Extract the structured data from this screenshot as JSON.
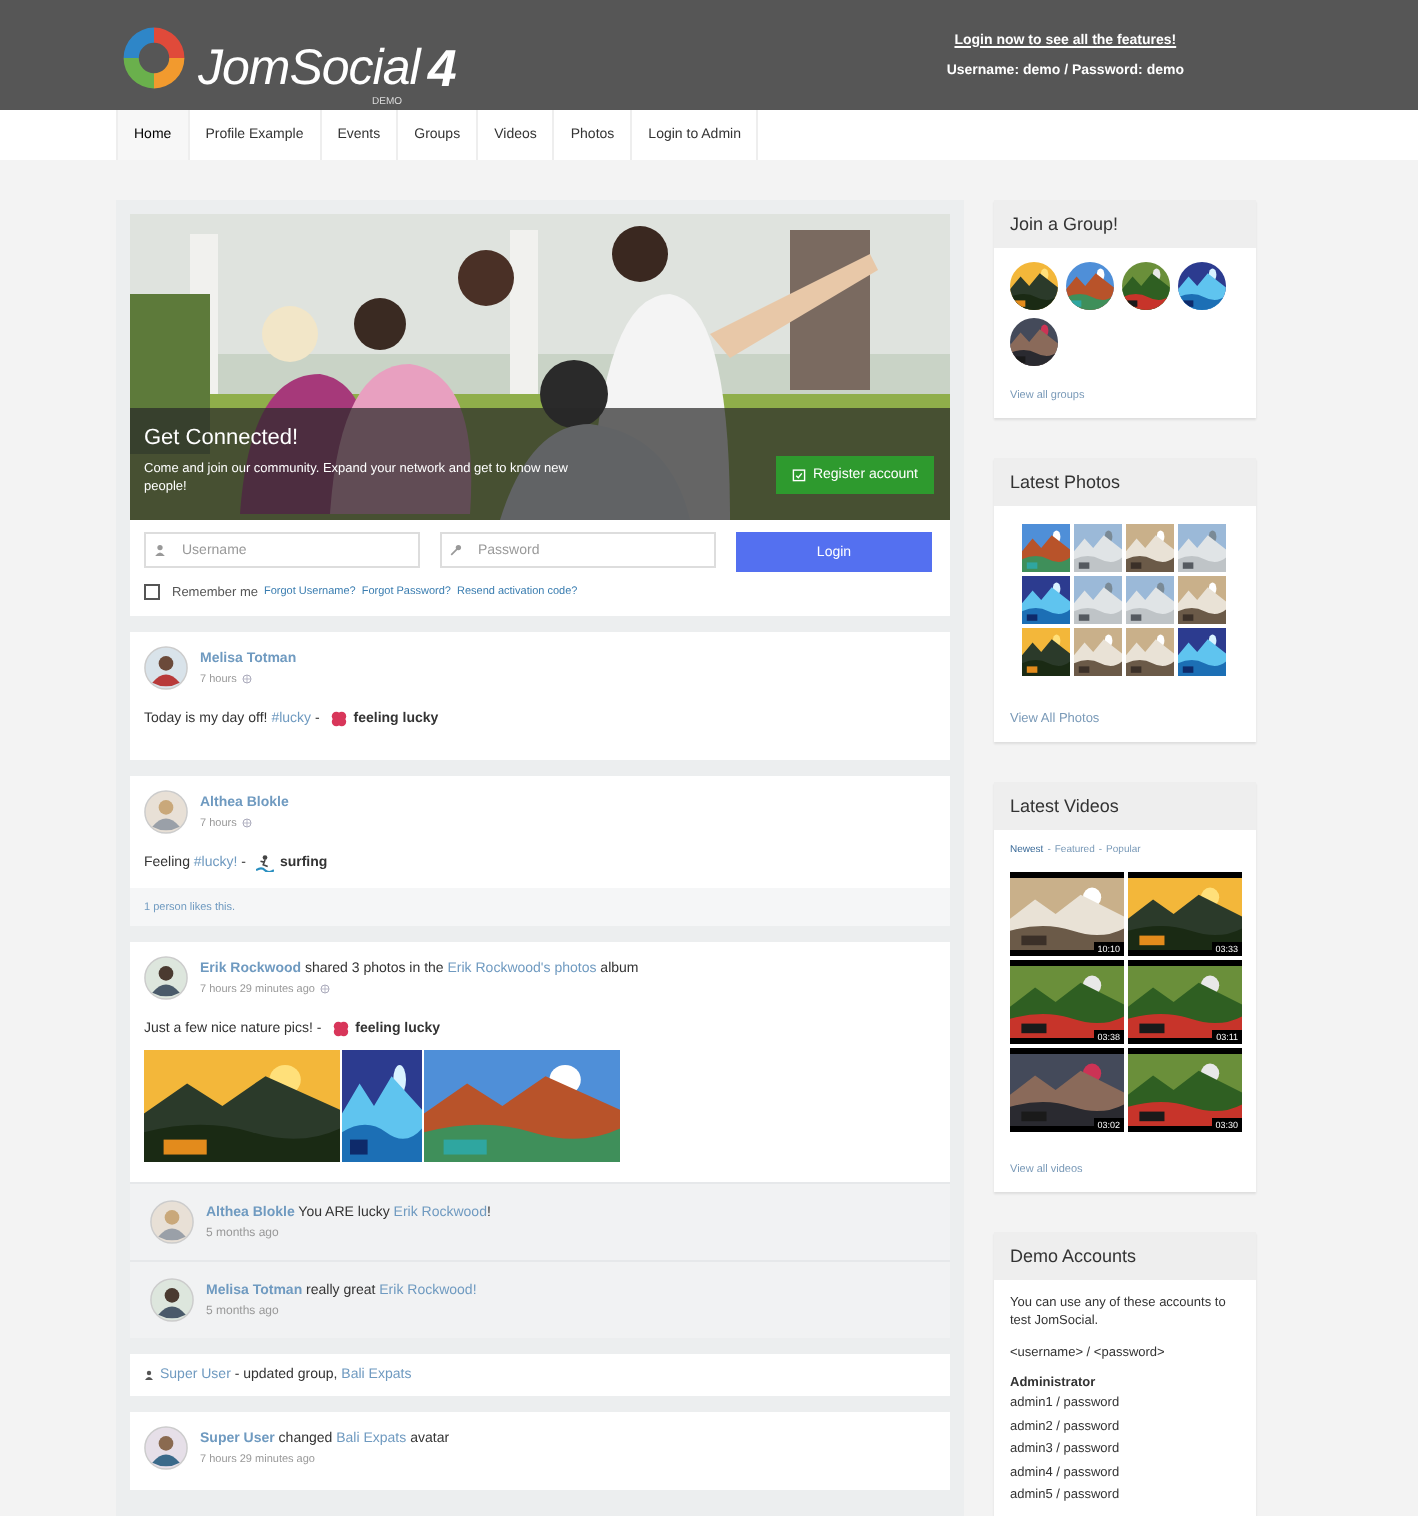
{
  "header": {
    "logo": {
      "name": "JomSocial",
      "version": "4",
      "edition": "DEMO"
    },
    "login_link": "Login now to see all the features!",
    "credentials": "Username: demo / Password: demo"
  },
  "nav": [
    {
      "label": "Home",
      "selected": true
    },
    {
      "label": "Profile Example",
      "selected": false
    },
    {
      "label": "Events",
      "selected": false
    },
    {
      "label": "Groups",
      "selected": false
    },
    {
      "label": "Videos",
      "selected": false
    },
    {
      "label": "Photos",
      "selected": false
    },
    {
      "label": "Login to Admin",
      "selected": false
    }
  ],
  "hero": {
    "kind": "picture",
    "title": "Get Connected!",
    "text": "Come and join our community. Expand your network and get to know new people!",
    "register_button": "Register account",
    "username": {
      "placeholder": "Username"
    },
    "password": {
      "placeholder": "Password"
    },
    "login_button": "Login",
    "remember": {
      "label": "Remember me",
      "checked": false
    },
    "links": [
      "Forgot Username?",
      "Forgot Password?",
      "Resend activation code?"
    ]
  },
  "feed": [
    {
      "kind": "post",
      "headline": [
        {
          "text": "Melisa Totman",
          "link": true
        }
      ],
      "time": "7 hours",
      "message": [
        {
          "text": "Today is my day off! "
        },
        {
          "text": "#lucky",
          "link": true
        },
        {
          "text": " - "
        }
      ],
      "mood": {
        "kind": "lucky",
        "label": "feeling lucky"
      }
    },
    {
      "kind": "post",
      "headline": [
        {
          "text": "Althea Blokle",
          "link": true
        }
      ],
      "time": "7 hours",
      "message": [
        {
          "text": "Feeling "
        },
        {
          "text": "#lucky!",
          "link": true
        },
        {
          "text": " - "
        }
      ],
      "mood": {
        "kind": "surfing",
        "label": "surfing"
      },
      "likes": "1 person likes this."
    },
    {
      "kind": "post",
      "headline": [
        {
          "text": "Erik Rockwood",
          "link": true
        },
        {
          "text": " shared 3 photos in the "
        },
        {
          "text": "Erik Rockwood's photos",
          "link": true
        },
        {
          "text": " album"
        }
      ],
      "time": "7 hours 29 minutes ago",
      "message": [
        {
          "text": "Just a few nice nature pics! - "
        }
      ],
      "mood": {
        "kind": "lucky",
        "label": "feeling lucky"
      },
      "photos": [
        {
          "kind": "picture"
        },
        {
          "kind": "picture"
        },
        {
          "kind": "picture"
        }
      ],
      "comments": [
        {
          "segments": [
            {
              "text": "Althea Blokle",
              "link": true
            },
            {
              "text": " You ARE lucky "
            },
            {
              "text": "Erik Rockwood",
              "link": true
            },
            {
              "text": "!"
            }
          ],
          "time": "5 months ago"
        },
        {
          "segments": [
            {
              "text": "Melisa Totman",
              "link": true
            },
            {
              "text": " really great "
            },
            {
              "text": "Erik Rockwood!",
              "link": true
            }
          ],
          "time": "5 months ago"
        }
      ]
    },
    {
      "kind": "notice",
      "segments": [
        {
          "text": "Super User",
          "link": true
        },
        {
          "text": " - updated group, "
        },
        {
          "text": "Bali Expats",
          "link": true
        }
      ]
    },
    {
      "kind": "post",
      "headline": [
        {
          "text": "Super User",
          "link": true
        },
        {
          "text": " changed "
        },
        {
          "text": "Bali Expats",
          "link": true
        },
        {
          "text": " avatar"
        }
      ],
      "time": "7 hours 29 minutes ago"
    }
  ],
  "sidebar": {
    "groups": {
      "title": "Join a Group!",
      "items": [
        {
          "kind": "picture"
        },
        {
          "kind": "picture"
        },
        {
          "kind": "picture"
        },
        {
          "kind": "picture"
        },
        {
          "kind": "picture"
        }
      ],
      "link": "View all groups"
    },
    "photos": {
      "title": "Latest Photos",
      "items": [
        {
          "kind": "picture"
        },
        {
          "kind": "picture"
        },
        {
          "kind": "picture"
        },
        {
          "kind": "picture"
        },
        {
          "kind": "picture"
        },
        {
          "kind": "picture"
        },
        {
          "kind": "picture"
        },
        {
          "kind": "picture"
        },
        {
          "kind": "picture"
        },
        {
          "kind": "picture"
        },
        {
          "kind": "picture"
        },
        {
          "kind": "picture"
        }
      ],
      "link": "View All Photos"
    },
    "videos": {
      "title": "Latest Videos",
      "separator": "-",
      "filters": [
        {
          "label": "Newest",
          "selected": true
        },
        {
          "label": "Featured",
          "selected": false
        },
        {
          "label": "Popular",
          "selected": false
        }
      ],
      "items": [
        {
          "kind": "picture",
          "duration": "10:10"
        },
        {
          "kind": "picture",
          "duration": "03:33"
        },
        {
          "kind": "picture",
          "duration": "03:38"
        },
        {
          "kind": "picture",
          "duration": "03:11"
        },
        {
          "kind": "picture",
          "duration": "03:02"
        },
        {
          "kind": "picture",
          "duration": "03:30"
        }
      ],
      "link": "View all videos"
    },
    "demo": {
      "title": "Demo Accounts",
      "intro": "You can use any of these accounts to test JomSocial.",
      "format": "<username> / <password>",
      "group": "Administrator",
      "accounts": [
        "admin1 / password",
        "admin2 / password",
        "admin3 / password",
        "admin4 / password",
        "admin5 / password"
      ]
    }
  }
}
